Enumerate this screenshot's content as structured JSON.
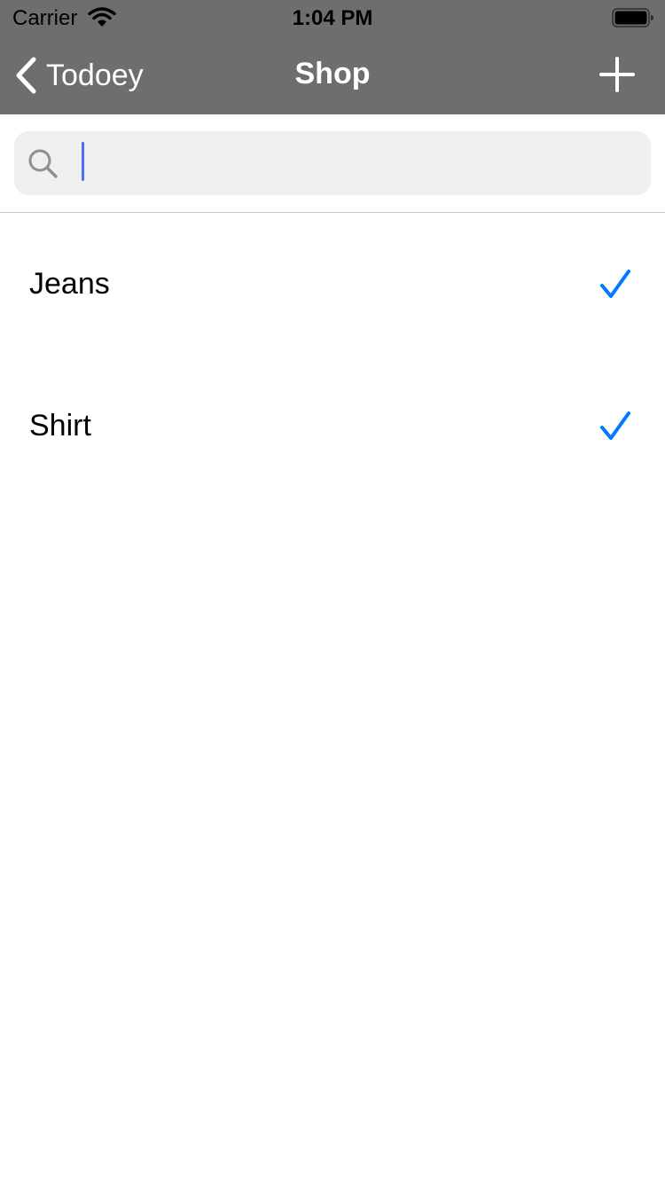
{
  "status_bar": {
    "carrier": "Carrier",
    "time": "1:04 PM",
    "wifi_icon": "wifi-icon",
    "battery_icon": "battery-icon"
  },
  "nav": {
    "back_label": "Todoey",
    "title": "Shop",
    "add_icon": "plus-icon",
    "back_icon": "chevron-left-icon",
    "bar_color": "#6e6e6e"
  },
  "search": {
    "placeholder": "",
    "value": "",
    "icon": "search-icon",
    "cursor_color": "#4c6ef5"
  },
  "items": [
    {
      "title": "Jeans",
      "checked": true
    },
    {
      "title": "Shirt",
      "checked": true
    }
  ],
  "check_color": "#007aff"
}
